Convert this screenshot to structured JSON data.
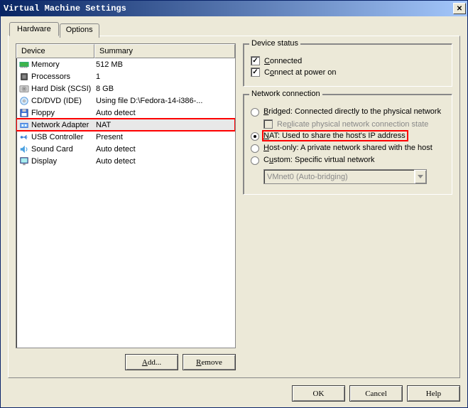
{
  "window": {
    "title": "Virtual Machine Settings"
  },
  "tabs": {
    "hardware": "Hardware",
    "options": "Options"
  },
  "device_list": {
    "headers": {
      "device": "Device",
      "summary": "Summary"
    },
    "items": [
      {
        "name": "Memory",
        "summary": "512 MB"
      },
      {
        "name": "Processors",
        "summary": "1"
      },
      {
        "name": "Hard Disk (SCSI)",
        "summary": "8 GB"
      },
      {
        "name": "CD/DVD (IDE)",
        "summary": "Using file D:\\Fedora-14-i386-..."
      },
      {
        "name": "Floppy",
        "summary": "Auto detect"
      },
      {
        "name": "Network Adapter",
        "summary": "NAT"
      },
      {
        "name": "USB Controller",
        "summary": "Present"
      },
      {
        "name": "Sound Card",
        "summary": "Auto detect"
      },
      {
        "name": "Display",
        "summary": "Auto detect"
      }
    ]
  },
  "left_btns": {
    "add": "Add...",
    "remove": "Remove"
  },
  "device_status": {
    "legend": "Device status",
    "connected": "Connected",
    "connect_power": "Connect at power on"
  },
  "network_conn": {
    "legend": "Network connection",
    "bridged": "Bridged: Connected directly to the physical network",
    "replicate": "Replicate physical network connection state",
    "nat": "NAT: Used to share the host's IP address",
    "hostonly": "Host-only: A private network shared with the host",
    "custom": "Custom: Specific virtual network",
    "custom_value": "VMnet0 (Auto-bridging)"
  },
  "bottom": {
    "ok": "OK",
    "cancel": "Cancel",
    "help": "Help"
  }
}
